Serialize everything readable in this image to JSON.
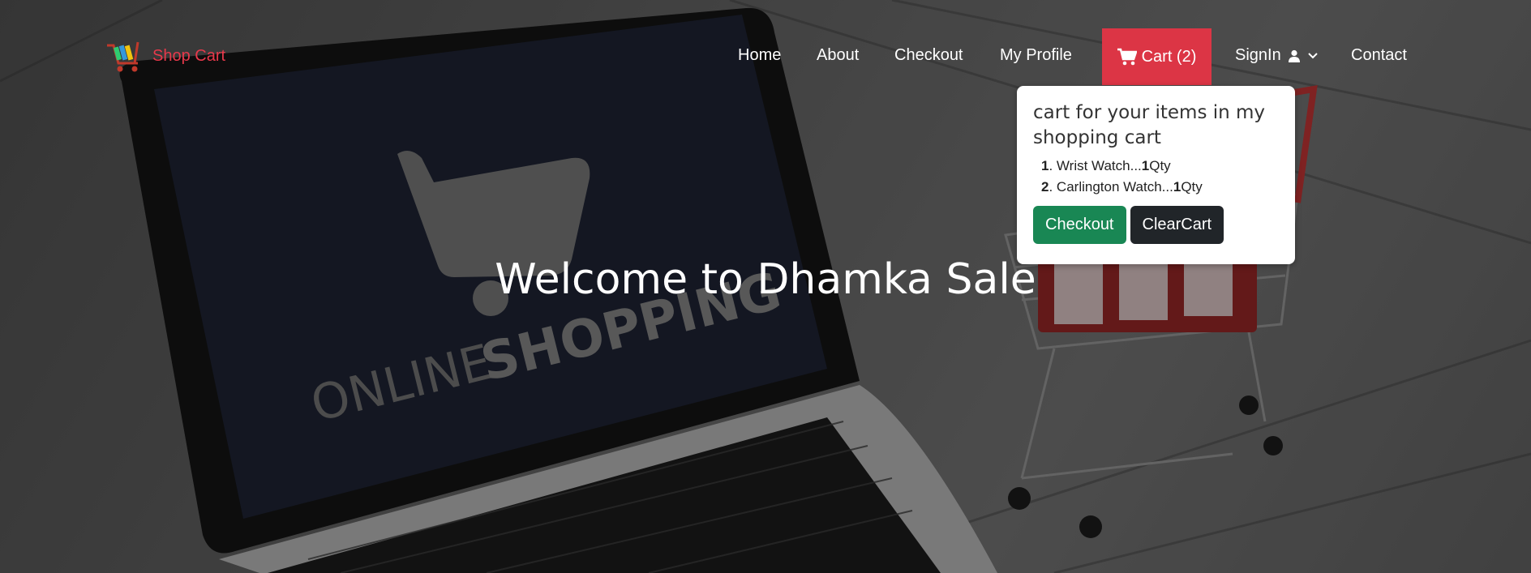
{
  "brand": {
    "label": "Shop Cart"
  },
  "nav": {
    "home": "Home",
    "about": "About",
    "checkout": "Checkout",
    "profile": "My Profile",
    "cart": "Cart (2)",
    "signin": "SignIn",
    "contact": "Contact"
  },
  "cart_popover": {
    "title": "cart for your items in my shopping cart",
    "items": [
      {
        "index": "1",
        "name": "Wrist Watch...",
        "qty": "1",
        "unit": "Qty"
      },
      {
        "index": "2",
        "name": "Carlington Watch...",
        "qty": "1",
        "unit": "Qty"
      }
    ],
    "checkout_label": "Checkout",
    "clear_label": "ClearCart"
  },
  "hero": {
    "heading": "Welcome to Dhamka Sale",
    "screen_text_light": "ONLINE",
    "screen_text_bold": "SHOPPING"
  },
  "colors": {
    "accent": "#dc3545",
    "success": "#198754",
    "dark": "#212529",
    "brand": "#e8394b"
  },
  "icons": [
    "cart-logo-icon",
    "shopping-cart-icon",
    "user-icon",
    "chevron-down-icon"
  ]
}
